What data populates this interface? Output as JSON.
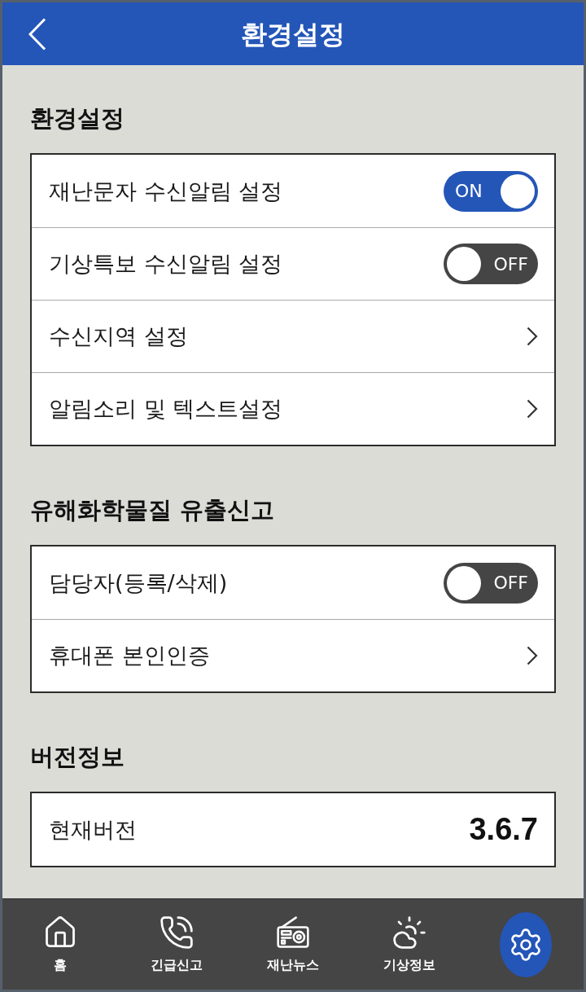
{
  "header": {
    "title": "환경설정"
  },
  "sections": [
    {
      "title": "환경설정",
      "rows": [
        {
          "kind": "toggle",
          "label": "재난문자 수신알림 설정",
          "on": true,
          "toggle_text": "ON"
        },
        {
          "kind": "toggle",
          "label": "기상특보 수신알림 설정",
          "on": false,
          "toggle_text": "OFF"
        },
        {
          "kind": "link",
          "label": "수신지역 설정"
        },
        {
          "kind": "link",
          "label": "알림소리 및 텍스트설정"
        }
      ]
    },
    {
      "title": "유해화학물질 유출신고",
      "rows": [
        {
          "kind": "toggle",
          "label": "담당자(등록/삭제)",
          "on": false,
          "toggle_text": "OFF"
        },
        {
          "kind": "link",
          "label": "휴대폰 본인인증"
        }
      ]
    },
    {
      "title": "버전정보",
      "rows": [
        {
          "kind": "value",
          "label": "현재버전",
          "value": "3.6.7"
        }
      ]
    }
  ],
  "bottom_nav": [
    {
      "label": "홈",
      "selected": false
    },
    {
      "label": "긴급신고",
      "selected": false
    },
    {
      "label": "재난뉴스",
      "selected": false
    },
    {
      "label": "기상정보",
      "selected": false
    },
    {
      "selected": true
    }
  ]
}
